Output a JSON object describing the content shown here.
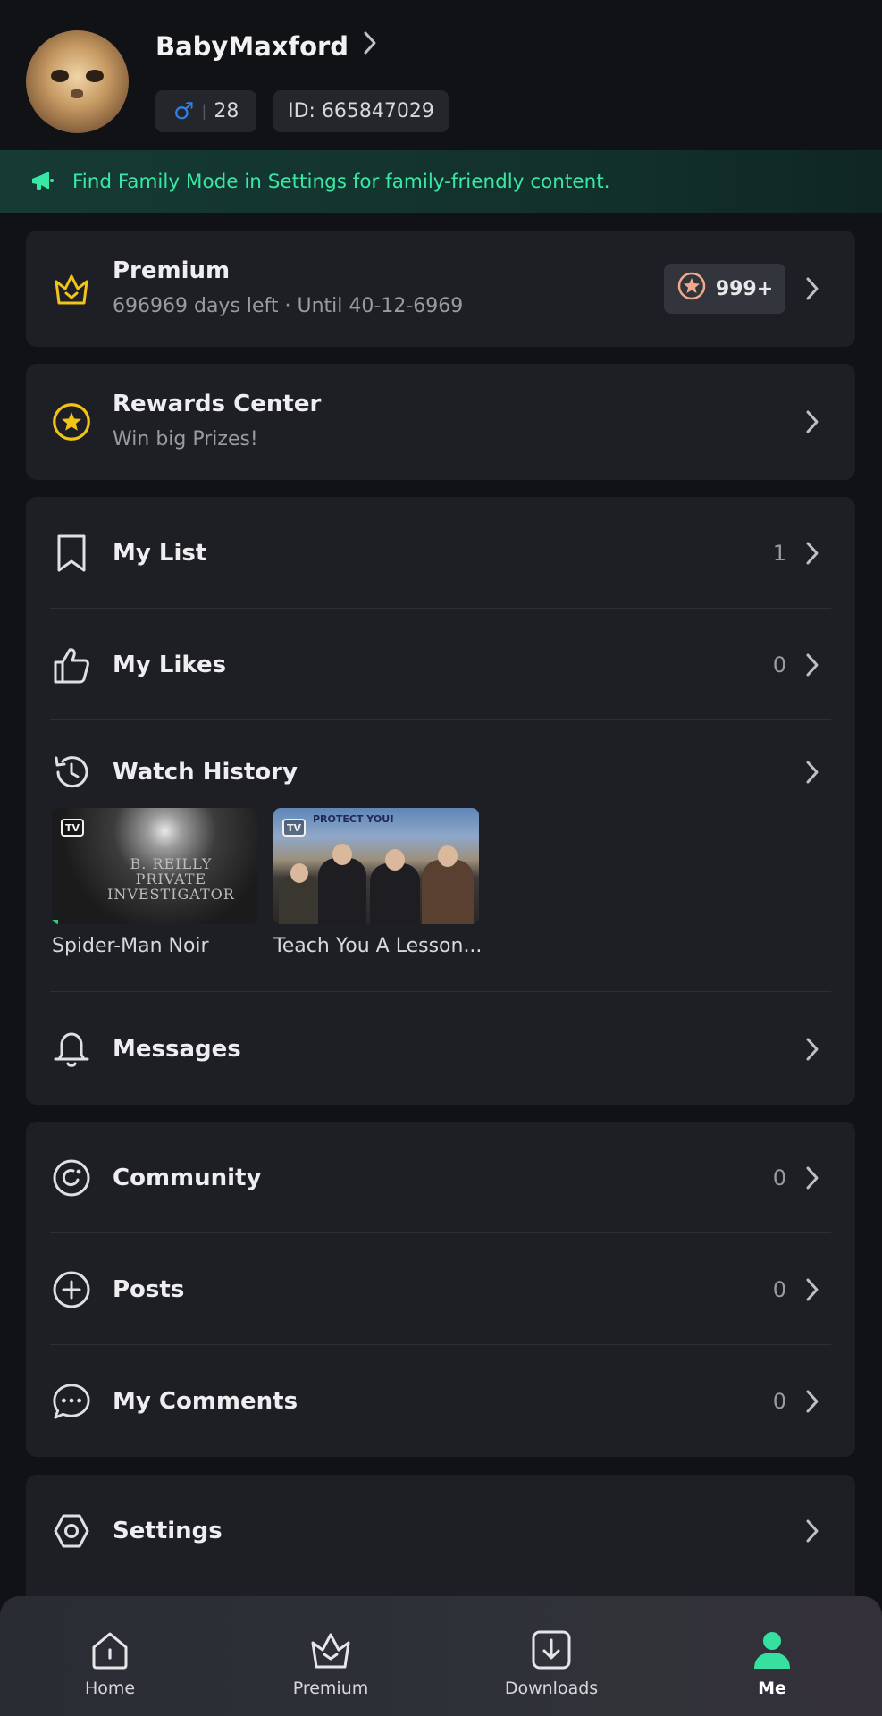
{
  "profile": {
    "username": "BabyMaxford",
    "gender_symbol": "♂",
    "age": "28",
    "id_text": "ID: 665847029"
  },
  "banner": {
    "text": "Find Family Mode in Settings for family-friendly content."
  },
  "premium": {
    "title": "Premium",
    "subtitle": "696969 days left · Until 40-12-6969",
    "coins": "999+"
  },
  "rewards": {
    "title": "Rewards Center",
    "subtitle": "Win big Prizes!"
  },
  "library": {
    "my_list": {
      "label": "My List",
      "count": "1"
    },
    "my_likes": {
      "label": "My Likes",
      "count": "0"
    },
    "watch_history": {
      "label": "Watch History",
      "items": [
        {
          "title": "Spider-Man Noir",
          "badge": "TV",
          "poster_text": "B. REILLY\nPRIVATE\nINVESTIGATOR",
          "progress": 0.03
        },
        {
          "title": "Teach You A Lesson...",
          "badge": "TV",
          "poster_text": "PROTECT YOU!",
          "progress": 0
        }
      ]
    },
    "messages": {
      "label": "Messages"
    }
  },
  "social": {
    "community": {
      "label": "Community",
      "count": "0"
    },
    "posts": {
      "label": "Posts",
      "count": "0"
    },
    "my_comments": {
      "label": "My Comments",
      "count": "0"
    }
  },
  "settings": {
    "label": "Settings"
  },
  "tabbar": {
    "active": "me",
    "items": [
      {
        "key": "home",
        "label": "Home",
        "icon": "home-icon"
      },
      {
        "key": "premium",
        "label": "Premium",
        "icon": "crown-icon"
      },
      {
        "key": "downloads",
        "label": "Downloads",
        "icon": "download-icon"
      },
      {
        "key": "me",
        "label": "Me",
        "icon": "person-icon"
      }
    ]
  },
  "colors": {
    "background": "#111216",
    "card": "#1e1f24",
    "accent_green": "#38e8a4",
    "gender_blue": "#2f7fe8",
    "gold": "#f2c417"
  }
}
